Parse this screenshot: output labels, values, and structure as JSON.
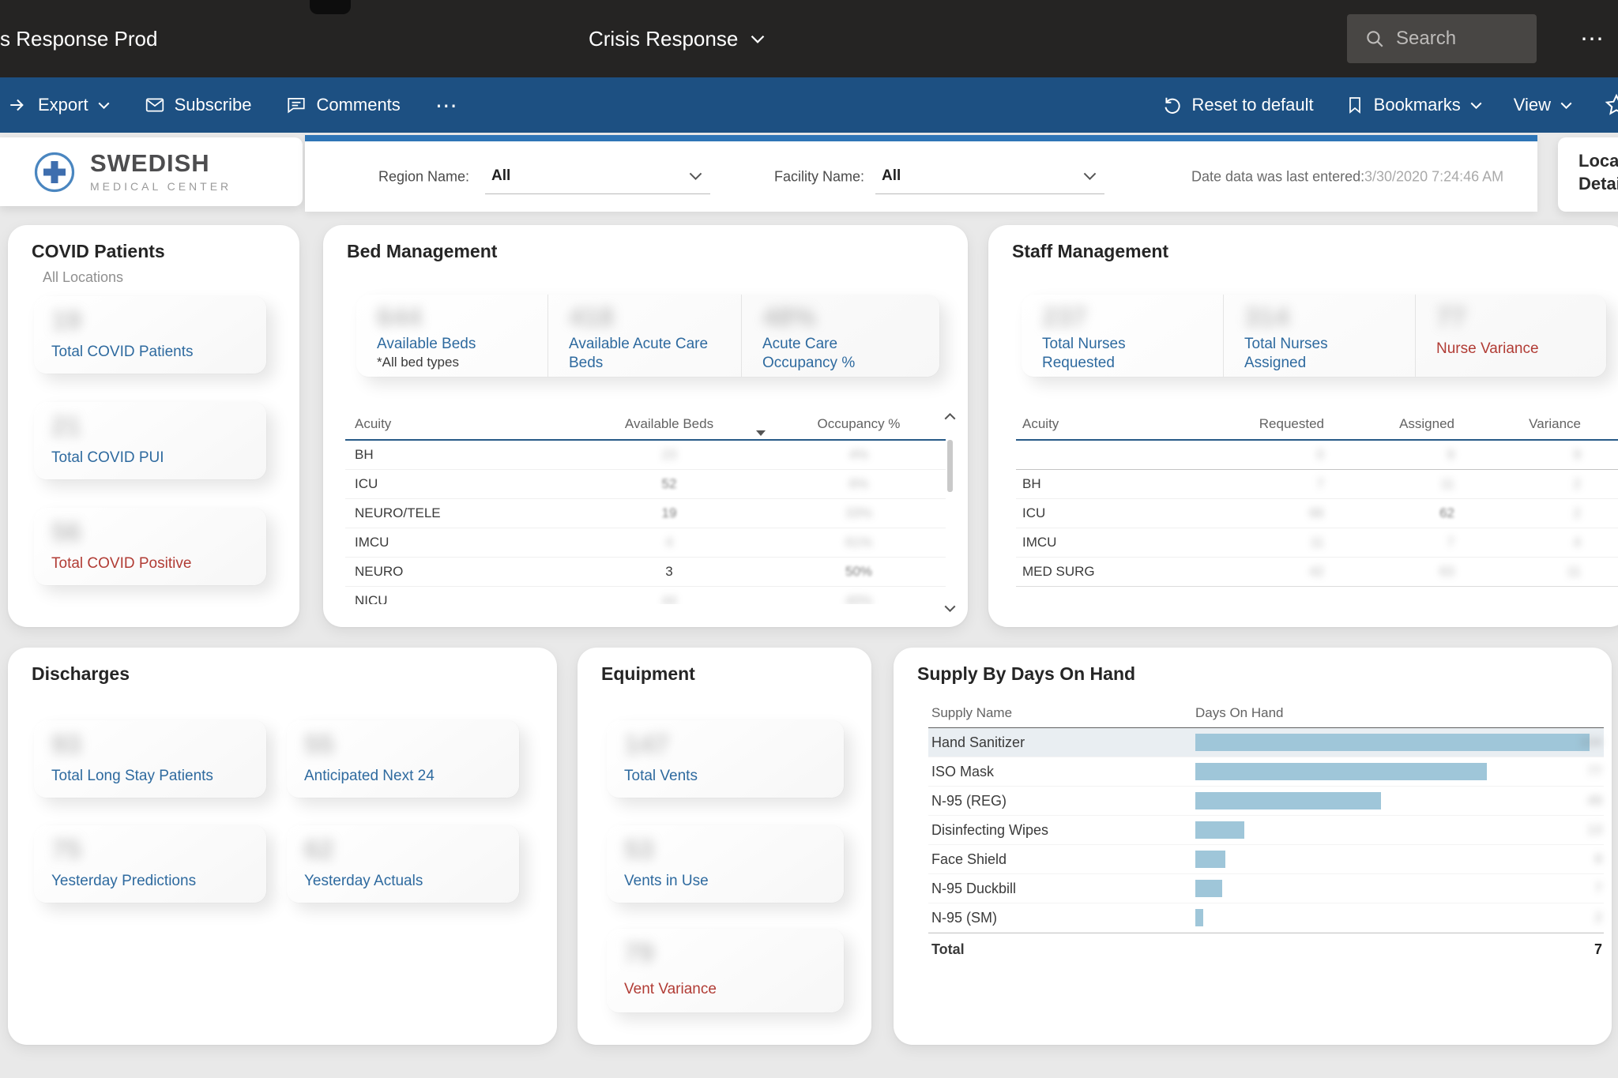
{
  "theme": {
    "accent": "#2e75b6",
    "bar_color": "#9fc6d9",
    "label_blue": "#2e6a9f",
    "alert_red": "#b13c35",
    "appbar_blue": "#1d5082",
    "topbar_black": "#252423"
  },
  "topbar": {
    "workspace": "Crisis Response Prod",
    "title": "Crisis Response",
    "search_placeholder": "Search",
    "more": "⋯"
  },
  "actionbar": {
    "export": "Export",
    "subscribe": "Subscribe",
    "comments": "Comments",
    "more": "⋯",
    "reset": "Reset to default",
    "bookmarks": "Bookmarks",
    "view": "View"
  },
  "filters": {
    "logo_line1": "SWEDISH",
    "logo_line2": "MEDICAL CENTER",
    "region_label": "Region Name:",
    "region_value": "All",
    "facility_label": "Facility Name:",
    "facility_value": "All",
    "date_label": "Date data was last entered:",
    "date_value": "3/30/2020 7:24:46 AM",
    "location_line1": "Location",
    "location_line2": "Details"
  },
  "covid": {
    "title": "COVID Patients",
    "subtitle": "All Locations",
    "tiles": [
      {
        "value": "19",
        "label": "Total COVID Patients"
      },
      {
        "value": "21",
        "label": "Total COVID PUI"
      },
      {
        "value": "56",
        "label": "Total COVID Positive"
      }
    ]
  },
  "bed": {
    "title": "Bed Management",
    "kpis": [
      {
        "value": "644",
        "label": "Available Beds",
        "sub": "*All bed types"
      },
      {
        "value": "418",
        "label": "Available Acute Care Beds"
      },
      {
        "value": "48%",
        "label": "Acute Care Occupancy %"
      }
    ],
    "headers": [
      "Acuity",
      "Available Beds",
      "Occupancy %"
    ],
    "rows": [
      [
        "BH",
        "23",
        "4%"
      ],
      [
        "ICU",
        "52",
        "6%"
      ],
      [
        "NEURO/TELE",
        "19",
        "33%"
      ],
      [
        "IMCU",
        "4",
        "61%"
      ],
      [
        "NEURO",
        "3",
        "50%"
      ],
      [
        "NICU",
        "44",
        "40%"
      ]
    ]
  },
  "staff": {
    "title": "Staff Management",
    "kpis": [
      {
        "value": "237",
        "label": "Total Nurses Requested"
      },
      {
        "value": "314",
        "label": "Total Nurses Assigned"
      },
      {
        "value": "77",
        "label": "Nurse Variance"
      }
    ],
    "headers": [
      "Acuity",
      "Requested",
      "Assigned",
      "Variance"
    ],
    "rows": [
      [
        "",
        "0",
        "9",
        "9"
      ],
      [
        "BH",
        "7",
        "11",
        "2"
      ],
      [
        "ICU",
        "66",
        "62",
        "2"
      ],
      [
        "IMCU",
        "11",
        "7",
        "4"
      ],
      [
        "MED SURG",
        "42",
        "63",
        "11"
      ]
    ]
  },
  "discharges": {
    "title": "Discharges",
    "tiles": [
      {
        "value": "93",
        "label": "Total Long Stay Patients"
      },
      {
        "value": "55",
        "label": "Anticipated Next 24"
      },
      {
        "value": "75",
        "label": "Yesterday Predictions"
      },
      {
        "value": "62",
        "label": "Yesterday Actuals"
      }
    ]
  },
  "equipment": {
    "title": "Equipment",
    "tiles": [
      {
        "value": "147",
        "label": "Total Vents"
      },
      {
        "value": "53",
        "label": "Vents in Use"
      },
      {
        "value": "79",
        "label": "Vent Variance"
      }
    ]
  },
  "supply": {
    "title": "Supply By Days On Hand",
    "col1": "Supply Name",
    "col2": "Days On Hand",
    "max": 104,
    "rows": [
      {
        "name": "Hand Sanitizer",
        "value": 104,
        "display": "104"
      },
      {
        "name": "ISO Mask",
        "value": 77,
        "display": "77"
      },
      {
        "name": "N-95 (REG)",
        "value": 49,
        "display": "49"
      },
      {
        "name": "Disinfecting Wipes",
        "value": 13,
        "display": "13"
      },
      {
        "name": "Face Shield",
        "value": 8,
        "display": "8"
      },
      {
        "name": "N-95 Duckbill",
        "value": 7,
        "display": "7"
      },
      {
        "name": "N-95 (SM)",
        "value": 2,
        "display": "2"
      }
    ],
    "total_label": "Total",
    "total_value": "7"
  }
}
